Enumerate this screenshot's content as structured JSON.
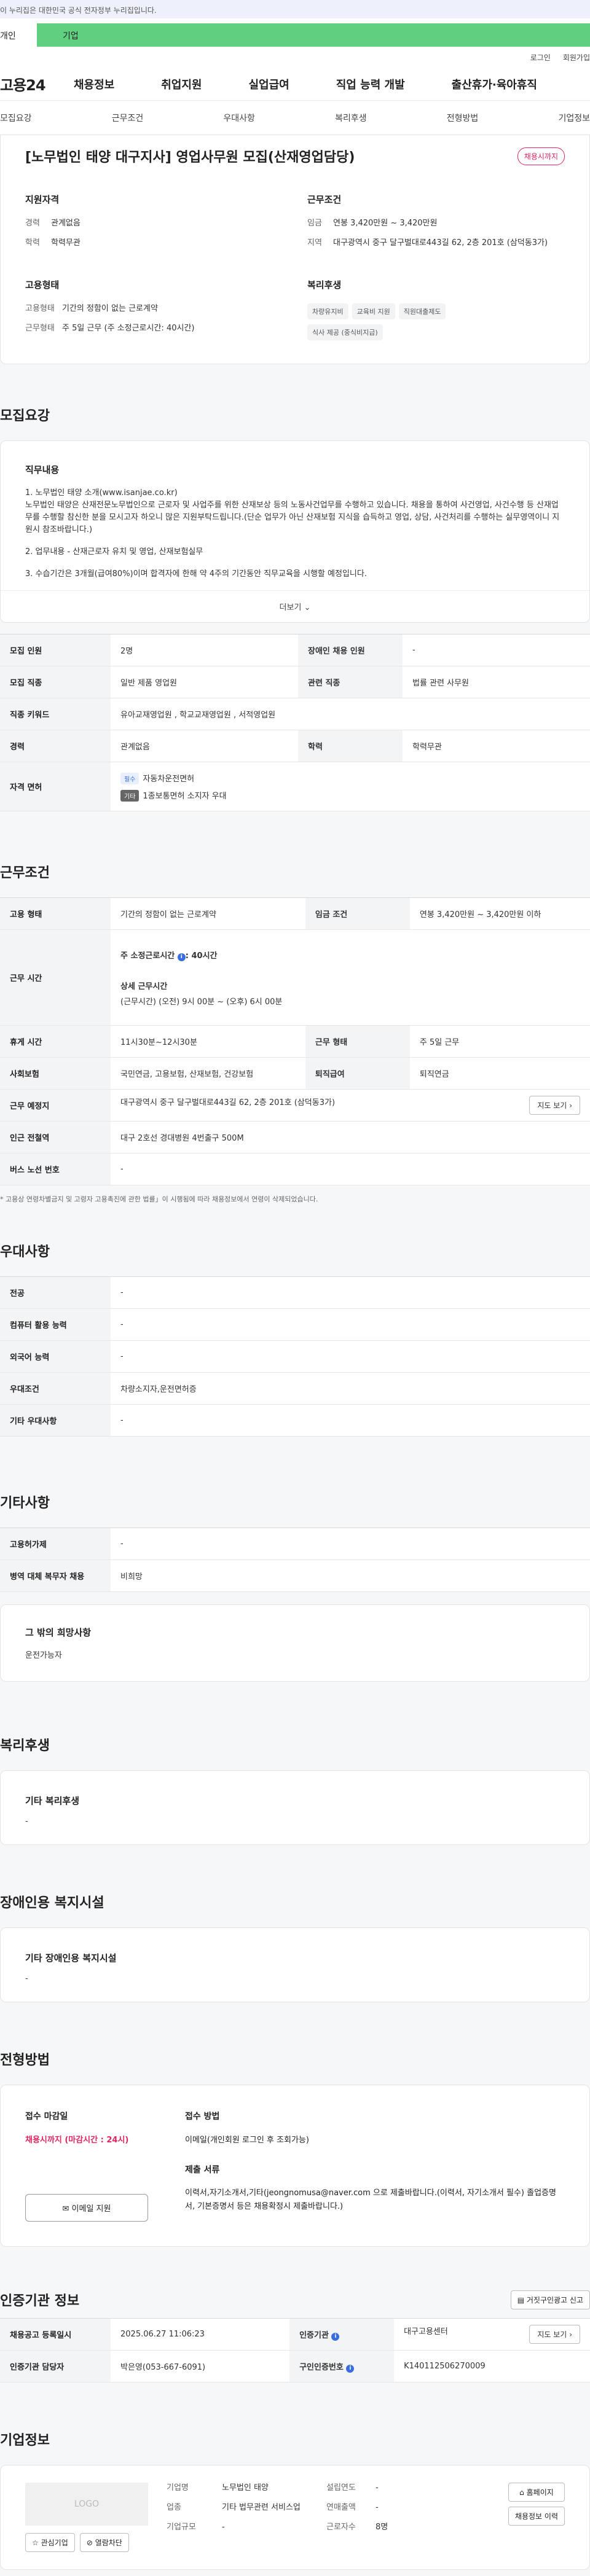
{
  "banner": {
    "text": "이 누리집은 대한민국 공식 전자정부 누리집입니다."
  },
  "utility": {
    "tab_personal": "개인",
    "tab_company": "기업"
  },
  "top_links": [
    "로그인",
    "회원가입"
  ],
  "gnb": {
    "logo": "고용24",
    "items": [
      "채용정보",
      "취업지원",
      "실업급여",
      "직업 능력 개발",
      "출산휴가·육아휴직"
    ]
  },
  "subnav": [
    "모집요강",
    "근무조건",
    "우대사항",
    "복리후생",
    "전형방법",
    "기업정보"
  ],
  "summary": {
    "title": "[노무법인 태양 대구지사] 영업사무원 모집(산재영업담당)",
    "status_badge": "채용시까지",
    "qualification": {
      "heading": "지원자격",
      "rows": [
        {
          "k": "경력",
          "v": "관계없음"
        },
        {
          "k": "학력",
          "v": "학력무관"
        }
      ]
    },
    "conditions": {
      "heading": "근무조건",
      "rows": [
        {
          "k": "임금",
          "v": "연봉 3,420만원 ~ 3,420만원"
        },
        {
          "k": "지역",
          "v": "대구광역시 중구 달구벌대로443길 62, 2층 201호 (삼덕동3가)"
        }
      ]
    },
    "employment": {
      "heading": "고용형태",
      "rows": [
        {
          "k": "고용형태",
          "v": "기간의 정함이 없는 근로계약"
        },
        {
          "k": "근무형태",
          "v": "주 5일 근무 (주 소정근로시간: 40시간)"
        }
      ]
    },
    "welfare": {
      "heading": "복리후생",
      "tags": [
        "차량유지비",
        "교육비 지원",
        "직원대출제도",
        "식사 제공 (중식비지급)"
      ]
    }
  },
  "recruit": {
    "heading": "모집요강",
    "duty_heading": "직무내용",
    "duty_paras": [
      "1. 노무법인 태양 소개(www.isanjae.co.kr)\n   노무법인 태양은 산재전문노무법인으로 근로자 및 사업주를 위한 산재보상 등의 노동사건업무를 수행하고 있습니다. 채용을 통하여 사건영업, 사건수행 등 산재업무를 수행할 참신한 분을 모시고자 하오니 많은 지원부탁드립니다.(단순 업무가 아닌 산재보험 지식을 습득하고 영업, 상담, 사건처리를 수행하는 실무영역이니 지원시 참조바랍니다.)",
      "2. 업무내용 - 산재근로자 유치 및 영업, 산재보험실무",
      "3. 수습기간은 3개월(급여80%)이며 합격자에 한해  약 4주의 기간동안 직무교육을 시행할 예정입니다."
    ],
    "more_label": "더보기",
    "table": [
      {
        "k1": "모집 인원",
        "v1": "2명",
        "k2": "장애인 채용 인원",
        "v2": "-"
      },
      {
        "k1": "모집 직종",
        "v1": "일반 제품 영업원",
        "k2": "관련 직종",
        "v2": "법률 관련 사무원"
      },
      {
        "k1": "직종 키워드",
        "v1": "유아교재영업원 , 학교교재영업원 , 서적영업원"
      },
      {
        "k1": "경력",
        "v1": "관계없음",
        "k2": "학력",
        "v2": "학력무관"
      }
    ],
    "license_label": "자격 면허",
    "licenses": [
      {
        "pill": "필수",
        "text": "자동차운전면허"
      },
      {
        "pill": "기타",
        "text": "1종보통면허 소지자 우대"
      }
    ]
  },
  "work": {
    "heading": "근무조건",
    "type_k": "고용 형태",
    "type_v": "기간의 정함이 없는 근로계약",
    "wage_k": "임금 조건",
    "wage_v": "연봉 3,420만원 ~ 3,420만원 이하",
    "hours_k": "근무 시간",
    "hours_main": "주 소정근로시간",
    "hours_main_v": ": 40시간",
    "hours_detail_h": "상세 근무시간",
    "hours_detail_v": "(근무시간) (오전) 9시 00분 ~ (오후) 6시 00분",
    "rest_k": "휴게 시간",
    "rest_v": "11시30분~12시30분",
    "shift_k": "근무 형태",
    "shift_v": "주 5일 근무",
    "ins_k": "사회보험",
    "ins_v": "국민연금, 고용보험, 산재보험, 건강보험",
    "sev_k": "퇴직급여",
    "sev_v": "퇴직연금",
    "loc_k": "근무 예정지",
    "loc_v": "대구광역시 중구 달구벌대로443길 62, 2층 201호 (삼덕동3가)",
    "map_label": "지도 보기",
    "subway_k": "인근 전철역",
    "subway_v": "대구 2호선 경대병원 4번출구 500M",
    "bus_k": "버스 노선 번호",
    "bus_v": "-",
    "note": "* 고용상 연령차별금지 및 고령자 고용촉진에 관한 법률」이 시행됨에 따라 채용정보에서 연령이 삭제되었습니다."
  },
  "pref": {
    "heading": "우대사항",
    "rows": [
      {
        "k": "전공",
        "v": "-"
      },
      {
        "k": "컴퓨터 활용 능력",
        "v": "-"
      },
      {
        "k": "외국어 능력",
        "v": "-"
      },
      {
        "k": "우대조건",
        "v": "차량소지자,운전면허증"
      },
      {
        "k": "기타 우대사항",
        "v": "-"
      }
    ]
  },
  "etc": {
    "heading": "기타사항",
    "rows": [
      {
        "k": "고용허가제",
        "v": "-"
      },
      {
        "k": "병역 대체 복무자 채용",
        "v": "비희망"
      }
    ],
    "other_h": "그 밖의 희망사항",
    "other_v": "운전가능자"
  },
  "welfare2": {
    "heading": "복리후생",
    "box_h": "기타 복리후생",
    "box_v": "-"
  },
  "disab": {
    "heading": "장애인용 복지시설",
    "box_h": "기타 장애인용 복지시설",
    "box_v": "-"
  },
  "apply": {
    "heading": "전형방법",
    "deadline_h": "접수 마감일",
    "deadline_v": "채용시까지 (마감시간 : 24시)",
    "email_btn": "이메일 지원",
    "method_h": "접수 방법",
    "method_v": "이메일(개인회원 로그인 후 조회가능)",
    "docs_h": "제출 서류",
    "docs_v": "이력서,자기소개서,기타(jeongnomusa@naver.com 으로 제출바랍니다.(이력서, 자기소개서 필수)   졸업증명서, 기본증명서 등은 채용확정시 제출바랍니다.)"
  },
  "cert": {
    "heading": "인증기관 정보",
    "report_btn": "거짓구인광고 신고",
    "rows": [
      {
        "k1": "채용공고 등록일시",
        "v1": "2025.06.27 11:06:23",
        "k2": "인증기관",
        "v2": "대구고용센터",
        "btn": "지도 보기"
      },
      {
        "k1": "인증기관 담당자",
        "v1": "박은영(053-667-6091)",
        "k2": "구인인증번호",
        "v2": "K140112506270009"
      }
    ]
  },
  "company": {
    "heading": "기업정보",
    "logo_text": "LOGO",
    "fav_btn": "관심기업",
    "block_btn": "열람차단",
    "rows": [
      {
        "k": "기업명",
        "v": "노무법인 태양"
      },
      {
        "k": "업종",
        "v": "기타 법무관련 서비스업"
      },
      {
        "k": "기업규모",
        "v": "-"
      }
    ],
    "rows2": [
      {
        "k": "설립연도",
        "v": "-"
      },
      {
        "k": "연매출액",
        "v": "-"
      },
      {
        "k": "근로자수",
        "v": "8명"
      }
    ],
    "home_btn": "홈페이지",
    "jobs_btn": "채용정보 이력"
  }
}
